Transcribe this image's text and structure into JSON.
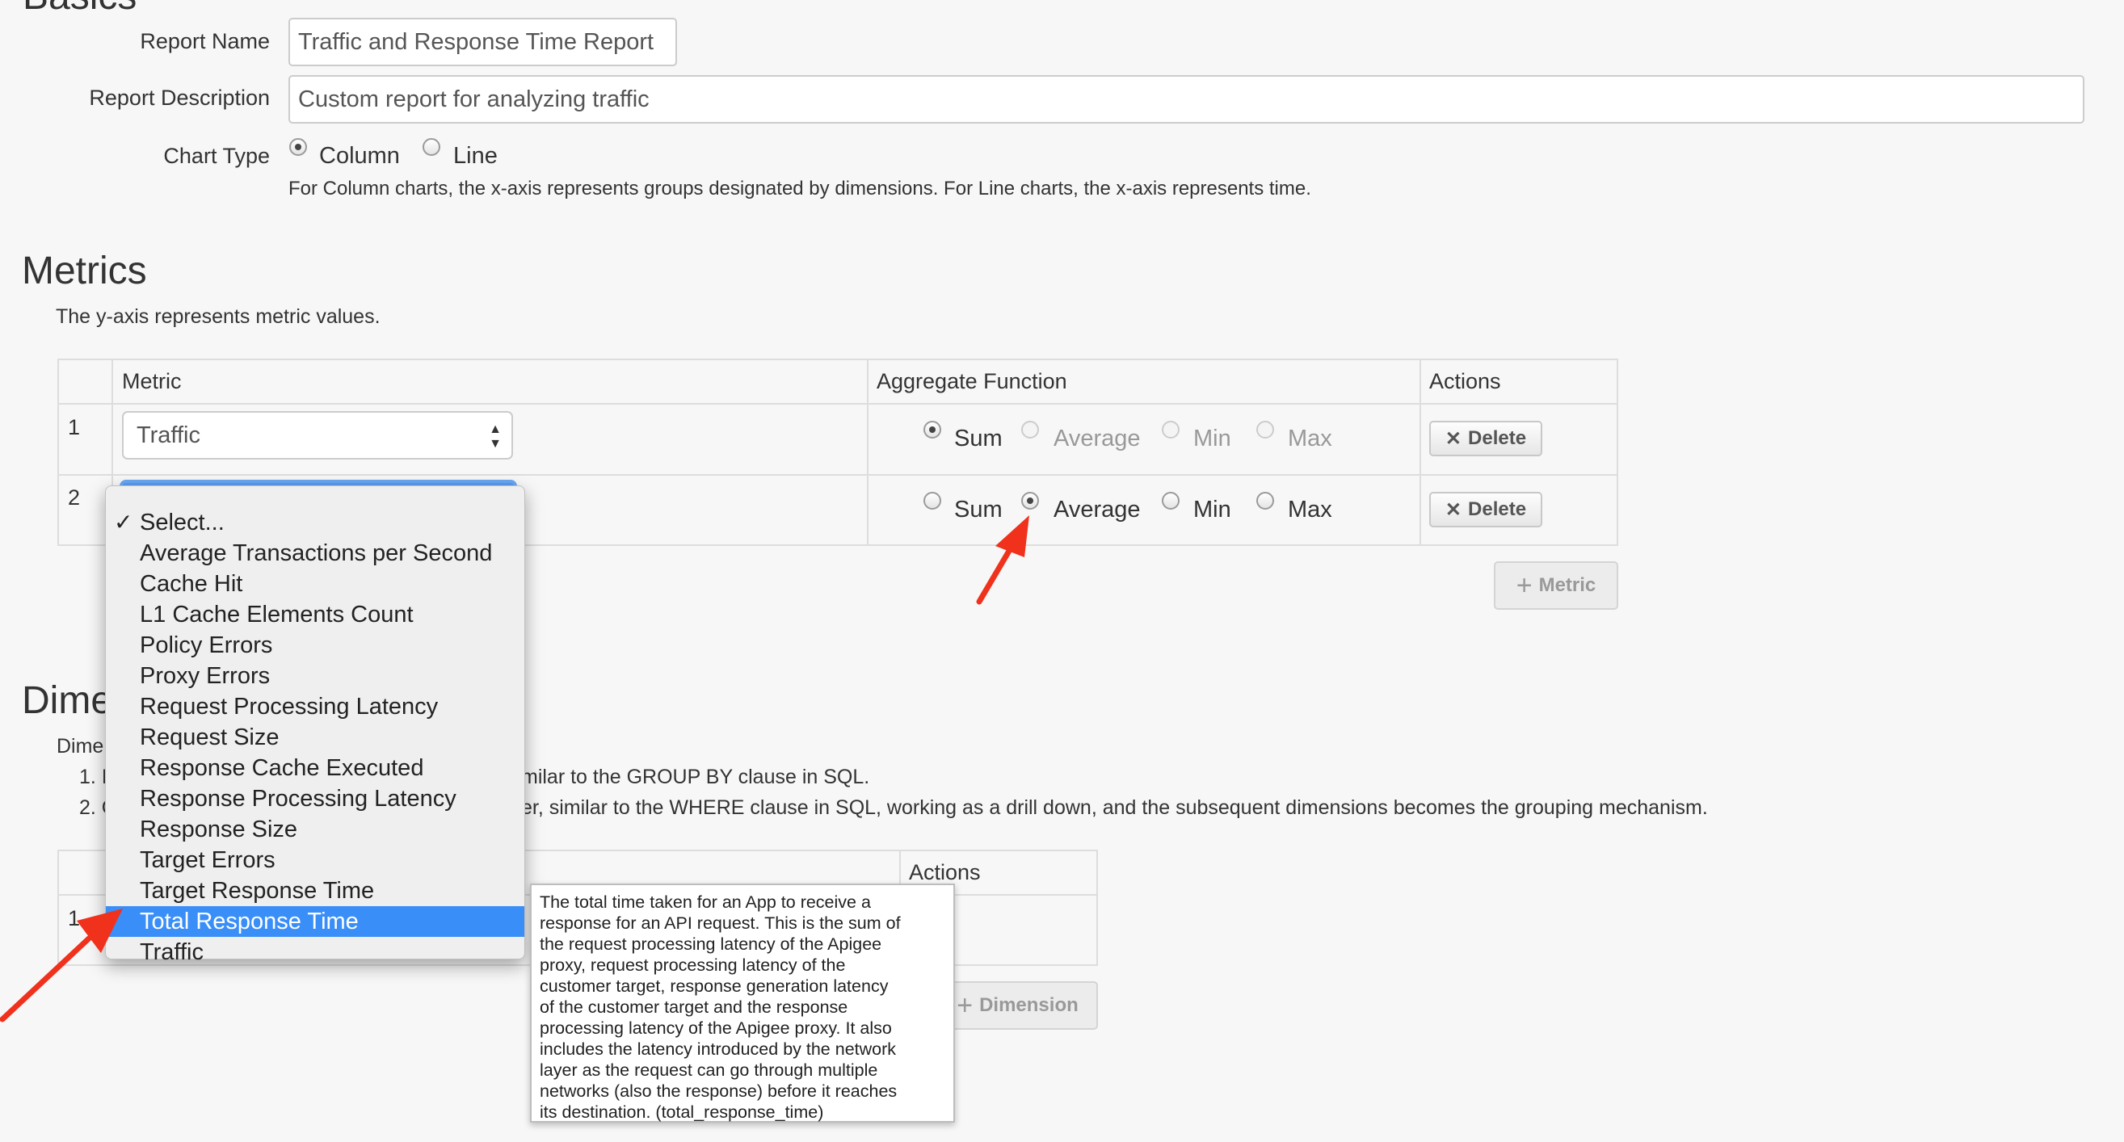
{
  "basics": {
    "section_title": "Basics",
    "report_name_label": "Report Name",
    "report_name_value": "Traffic and Response Time Report",
    "report_desc_label": "Report Description",
    "report_desc_value": "Custom report for analyzing traffic",
    "chart_type_label": "Chart Type",
    "chart_type_options": [
      "Column",
      "Line"
    ],
    "chart_type_selected": "Column",
    "chart_type_help": "For Column charts, the x-axis represents groups designated by dimensions. For Line charts, the x-axis represents time."
  },
  "metrics": {
    "title": "Metrics",
    "subtitle": "The y-axis represents metric values.",
    "columns": [
      "Metric",
      "Aggregate Function",
      "Actions"
    ],
    "rows": [
      {
        "num": "1",
        "metric": "Traffic",
        "aggregate": [
          "Sum",
          "Average",
          "Min",
          "Max"
        ],
        "selected": "Sum",
        "delete_label": "Delete"
      },
      {
        "num": "2",
        "metric": "Select...",
        "aggregate": [
          "Sum",
          "Average",
          "Min",
          "Max"
        ],
        "selected": "Average",
        "delete_label": "Delete"
      }
    ],
    "add_button": "Metric"
  },
  "dimensions": {
    "title_partial": "Dime",
    "intro_partial": "Dime",
    "bullets": [
      {
        "num": "1. I",
        "text": "milar to the GROUP BY clause in SQL."
      },
      {
        "num": "2. C",
        "text": "er, similar to the WHERE clause in SQL, working as a drill down, and the subsequent dimensions becomes the grouping mechanism."
      }
    ],
    "actions_column": "Actions",
    "row_num": "1",
    "add_button": "Dimension"
  },
  "dropdown": {
    "options": [
      "Select...",
      "Average Transactions per Second",
      "Cache Hit",
      "L1 Cache Elements Count",
      "Policy Errors",
      "Proxy Errors",
      "Request Processing Latency",
      "Request Size",
      "Response Cache Executed",
      "Response Processing Latency",
      "Response Size",
      "Target Errors",
      "Target Response Time",
      "Total Response Time",
      "Traffic"
    ],
    "checked": "Select...",
    "highlighted": "Total Response Time"
  },
  "tooltip": {
    "lines": [
      "The total time taken for an App to receive a",
      "response for an API request. This is the sum of",
      "the request processing latency of the Apigee",
      "proxy, request processing latency of the",
      "customer target, response generation latency",
      "of the customer target and the response",
      "processing latency of the Apigee proxy. It also",
      "includes the latency introduced by the network",
      "layer as the request can go through multiple",
      "networks (also the response) before it reaches",
      "its destination. (total_response_time)"
    ]
  },
  "colors": {
    "highlight": "#3a8ef7",
    "arrow": "#f0311c"
  }
}
